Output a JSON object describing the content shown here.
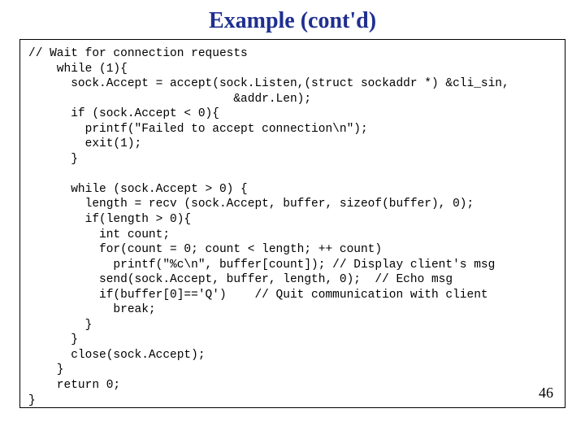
{
  "title": "Example (cont'd)",
  "page": "46",
  "code": "// Wait for connection requests\n    while (1){\n      sock.Accept = accept(sock.Listen,(struct sockaddr *) &cli_sin,\n                             &addr.Len);\n      if (sock.Accept < 0){\n        printf(\"Failed to accept connection\\n\");\n        exit(1);\n      }\n\n      while (sock.Accept > 0) {\n        length = recv (sock.Accept, buffer, sizeof(buffer), 0);\n        if(length > 0){\n          int count;\n          for(count = 0; count < length; ++ count)\n            printf(\"%c\\n\", buffer[count]); // Display client's msg\n          send(sock.Accept, buffer, length, 0);  // Echo msg\n          if(buffer[0]=='Q')    // Quit communication with client\n            break;\n        }\n      }\n      close(sock.Accept);\n    }\n    return 0;\n}"
}
